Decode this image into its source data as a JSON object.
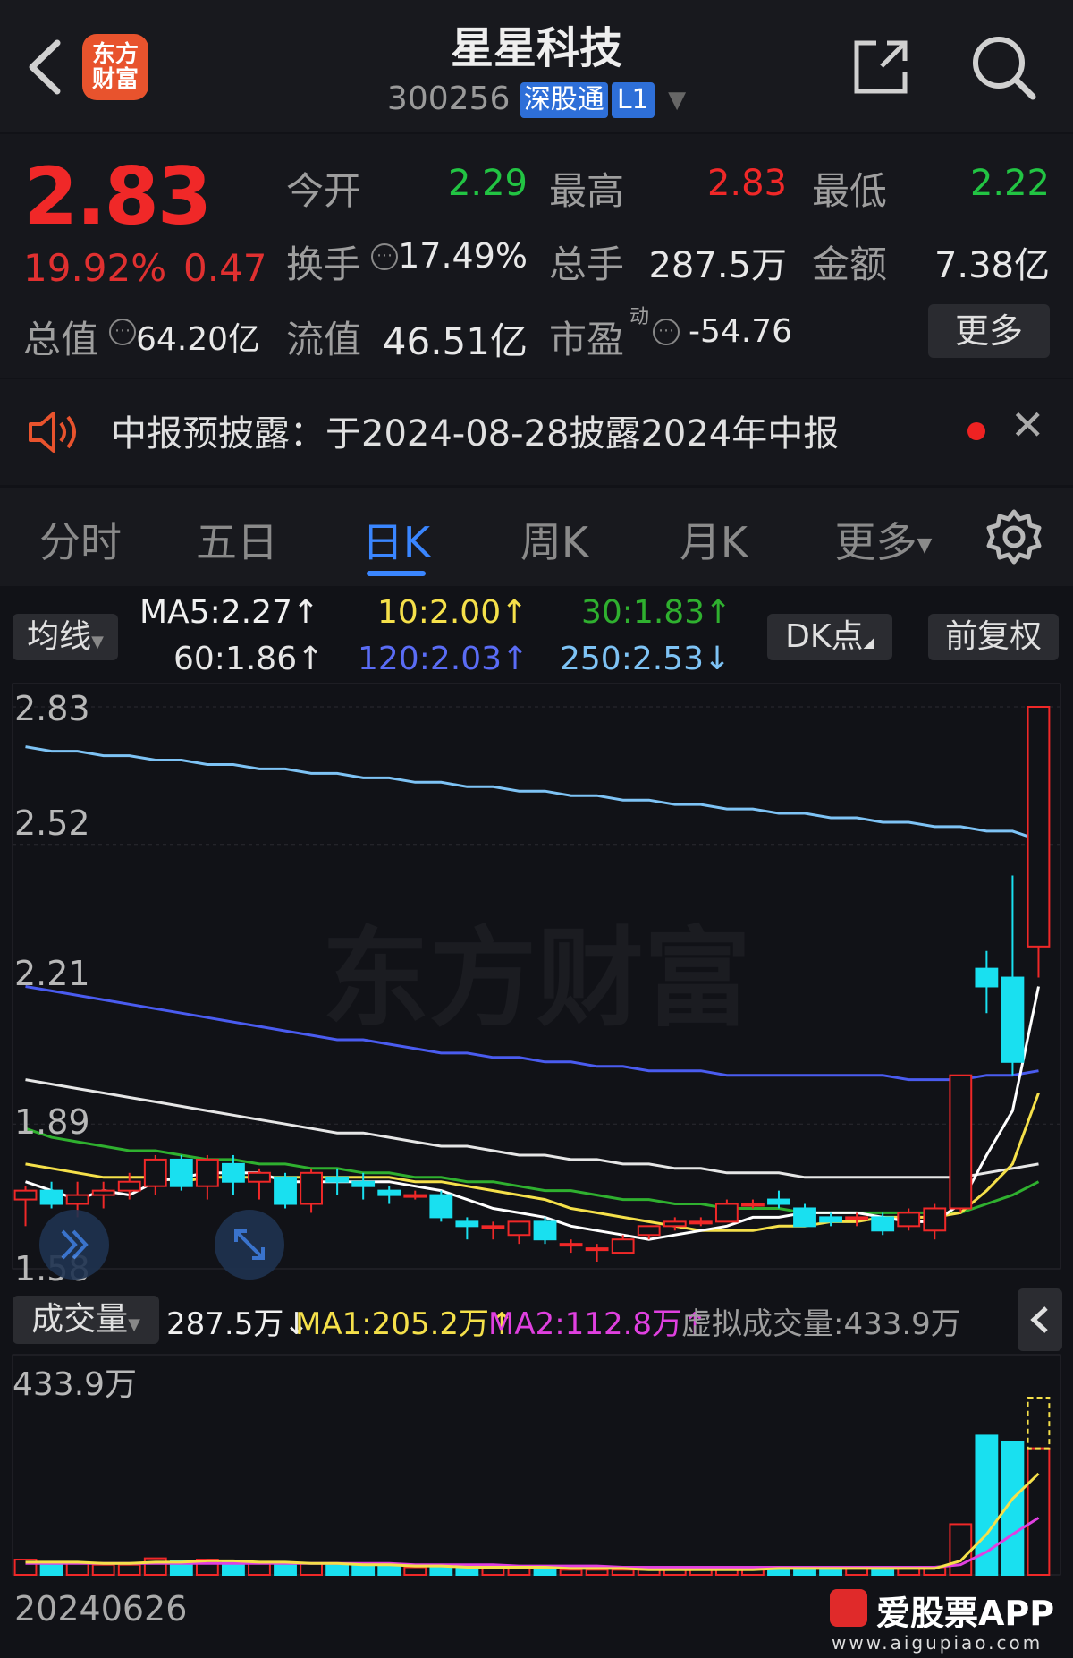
{
  "header": {
    "logo_line1": "东方",
    "logo_line2": "财富",
    "stock_name": "星星科技",
    "stock_code": "300256",
    "tag_connect": "深股通",
    "tag_level": "L1"
  },
  "quote": {
    "price": "2.83",
    "change_pct": "19.92%",
    "change": "0.47",
    "open_label": "今开",
    "open": "2.29",
    "high_label": "最高",
    "high": "2.83",
    "low_label": "最低",
    "low": "2.22",
    "turnover_label": "换手",
    "turnover": "17.49%",
    "volume_label": "总手",
    "volume": "287.5万",
    "amount_label": "金额",
    "amount": "7.38亿",
    "mktcap_label": "总值",
    "mktcap": "64.20亿",
    "float_label": "流值",
    "float_cap": "46.51亿",
    "pe_label": "市盈",
    "pe_super": "动",
    "pe": "-54.76",
    "more_label": "更多"
  },
  "notice": {
    "text": "中报预披露：于2024-08-28披露2024年中报"
  },
  "tabs": [
    {
      "label": "分时",
      "active": false
    },
    {
      "label": "五日",
      "active": false
    },
    {
      "label": "日K",
      "active": true
    },
    {
      "label": "周K",
      "active": false
    },
    {
      "label": "月K",
      "active": false
    },
    {
      "label": "更多",
      "active": false
    }
  ],
  "ma_bar": {
    "selector": "均线",
    "ma5": "MA5:2.27↑",
    "ma10": "10:2.00↑",
    "ma30": "30:1.83↑",
    "ma60": "60:1.86↑",
    "ma120": "120:2.03↑",
    "ma250": "250:2.53↓",
    "dk_button": "DK点",
    "adjust_button": "前复权"
  },
  "chart_labels": {
    "y_labels": [
      "2.83",
      "2.52",
      "2.21",
      "1.89",
      "1.58"
    ],
    "watermark": "东方财富"
  },
  "volume_bar": {
    "selector": "成交量",
    "vol": "287.5万↓",
    "ma1": "MA1:205.2万↑",
    "ma2": "MA2:112.8万↑",
    "virtual": "虚拟成交量:433.9万",
    "max_label": "433.9万",
    "date_label": "20240626"
  },
  "footer": {
    "brand": "爱股票APP",
    "url": "www.aigupiao.com"
  },
  "colors": {
    "up": "#f02828",
    "down": "#19e0f0",
    "accent": "#3a86ff",
    "ma5": "#ffffff",
    "ma10": "#f5e04a",
    "ma30": "#2fb02f",
    "ma60": "#e6e6e6",
    "ma120": "#4a5cf0",
    "ma250": "#7ec3f5",
    "vol_ma1": "#f5e04a",
    "vol_ma2": "#e040e0"
  },
  "chart_data": {
    "type": "candlestick",
    "y_range": [
      1.58,
      2.83
    ],
    "candles": [
      {
        "o": 1.72,
        "h": 1.75,
        "l": 1.66,
        "c": 1.74,
        "v": 12
      },
      {
        "o": 1.74,
        "h": 1.76,
        "l": 1.7,
        "c": 1.71,
        "v": 10
      },
      {
        "o": 1.71,
        "h": 1.76,
        "l": 1.68,
        "c": 1.73,
        "v": 9
      },
      {
        "o": 1.73,
        "h": 1.76,
        "l": 1.7,
        "c": 1.74,
        "v": 8
      },
      {
        "o": 1.74,
        "h": 1.78,
        "l": 1.72,
        "c": 1.76,
        "v": 8
      },
      {
        "o": 1.75,
        "h": 1.82,
        "l": 1.73,
        "c": 1.81,
        "v": 13
      },
      {
        "o": 1.81,
        "h": 1.82,
        "l": 1.74,
        "c": 1.75,
        "v": 11
      },
      {
        "o": 1.75,
        "h": 1.82,
        "l": 1.72,
        "c": 1.81,
        "v": 12
      },
      {
        "o": 1.8,
        "h": 1.82,
        "l": 1.73,
        "c": 1.76,
        "v": 10
      },
      {
        "o": 1.76,
        "h": 1.79,
        "l": 1.72,
        "c": 1.78,
        "v": 9
      },
      {
        "o": 1.77,
        "h": 1.78,
        "l": 1.7,
        "c": 1.71,
        "v": 9
      },
      {
        "o": 1.71,
        "h": 1.79,
        "l": 1.69,
        "c": 1.78,
        "v": 9
      },
      {
        "o": 1.77,
        "h": 1.79,
        "l": 1.73,
        "c": 1.76,
        "v": 8
      },
      {
        "o": 1.76,
        "h": 1.78,
        "l": 1.72,
        "c": 1.75,
        "v": 7
      },
      {
        "o": 1.74,
        "h": 1.75,
        "l": 1.71,
        "c": 1.73,
        "v": 7
      },
      {
        "o": 1.73,
        "h": 1.74,
        "l": 1.72,
        "c": 1.73,
        "v": 6
      },
      {
        "o": 1.73,
        "h": 1.74,
        "l": 1.67,
        "c": 1.68,
        "v": 7
      },
      {
        "o": 1.67,
        "h": 1.68,
        "l": 1.63,
        "c": 1.66,
        "v": 5
      },
      {
        "o": 1.66,
        "h": 1.67,
        "l": 1.63,
        "c": 1.66,
        "v": 5
      },
      {
        "o": 1.64,
        "h": 1.67,
        "l": 1.62,
        "c": 1.67,
        "v": 5
      },
      {
        "o": 1.67,
        "h": 1.68,
        "l": 1.62,
        "c": 1.63,
        "v": 5
      },
      {
        "o": 1.62,
        "h": 1.63,
        "l": 1.6,
        "c": 1.62,
        "v": 4
      },
      {
        "o": 1.61,
        "h": 1.62,
        "l": 1.58,
        "c": 1.61,
        "v": 4
      },
      {
        "o": 1.6,
        "h": 1.64,
        "l": 1.6,
        "c": 1.63,
        "v": 4
      },
      {
        "o": 1.64,
        "h": 1.66,
        "l": 1.63,
        "c": 1.66,
        "v": 4
      },
      {
        "o": 1.66,
        "h": 1.68,
        "l": 1.65,
        "c": 1.67,
        "v": 4
      },
      {
        "o": 1.67,
        "h": 1.68,
        "l": 1.66,
        "c": 1.67,
        "v": 4
      },
      {
        "o": 1.67,
        "h": 1.72,
        "l": 1.67,
        "c": 1.71,
        "v": 5
      },
      {
        "o": 1.71,
        "h": 1.72,
        "l": 1.7,
        "c": 1.71,
        "v": 5
      },
      {
        "o": 1.72,
        "h": 1.74,
        "l": 1.7,
        "c": 1.71,
        "v": 5
      },
      {
        "o": 1.7,
        "h": 1.71,
        "l": 1.66,
        "c": 1.66,
        "v": 5
      },
      {
        "o": 1.68,
        "h": 1.69,
        "l": 1.66,
        "c": 1.67,
        "v": 5
      },
      {
        "o": 1.68,
        "h": 1.69,
        "l": 1.66,
        "c": 1.68,
        "v": 5
      },
      {
        "o": 1.68,
        "h": 1.69,
        "l": 1.64,
        "c": 1.65,
        "v": 5
      },
      {
        "o": 1.66,
        "h": 1.7,
        "l": 1.65,
        "c": 1.69,
        "v": 6
      },
      {
        "o": 1.65,
        "h": 1.71,
        "l": 1.63,
        "c": 1.7,
        "v": 6
      },
      {
        "o": 1.7,
        "h": 2.0,
        "l": 1.69,
        "c": 2.0,
        "v": 40
      },
      {
        "o": 2.24,
        "h": 2.28,
        "l": 2.14,
        "c": 2.2,
        "v": 110
      },
      {
        "o": 2.22,
        "h": 2.45,
        "l": 2.0,
        "c": 2.03,
        "v": 105
      },
      {
        "o": 2.29,
        "h": 2.83,
        "l": 2.22,
        "c": 2.83,
        "v": 100
      }
    ],
    "vol_max_virtual": 140,
    "lines": {
      "ma5": [
        1.76,
        1.74,
        1.72,
        1.74,
        1.73,
        1.76,
        1.77,
        1.78,
        1.78,
        1.78,
        1.76,
        1.76,
        1.76,
        1.76,
        1.76,
        1.75,
        1.74,
        1.72,
        1.7,
        1.69,
        1.68,
        1.66,
        1.65,
        1.64,
        1.63,
        1.64,
        1.65,
        1.66,
        1.68,
        1.68,
        1.69,
        1.69,
        1.69,
        1.68,
        1.67,
        1.67,
        1.71,
        1.82,
        1.92,
        2.2
      ],
      "ma10": [
        1.8,
        1.79,
        1.78,
        1.77,
        1.77,
        1.77,
        1.76,
        1.77,
        1.77,
        1.77,
        1.77,
        1.77,
        1.77,
        1.77,
        1.77,
        1.76,
        1.76,
        1.75,
        1.74,
        1.73,
        1.72,
        1.7,
        1.69,
        1.68,
        1.67,
        1.66,
        1.65,
        1.65,
        1.65,
        1.66,
        1.66,
        1.67,
        1.67,
        1.68,
        1.68,
        1.68,
        1.69,
        1.74,
        1.8,
        1.96
      ],
      "ma30": [
        1.88,
        1.86,
        1.85,
        1.84,
        1.83,
        1.83,
        1.82,
        1.81,
        1.81,
        1.8,
        1.8,
        1.79,
        1.79,
        1.78,
        1.78,
        1.77,
        1.77,
        1.76,
        1.76,
        1.75,
        1.74,
        1.74,
        1.73,
        1.72,
        1.72,
        1.71,
        1.71,
        1.7,
        1.7,
        1.7,
        1.69,
        1.69,
        1.69,
        1.69,
        1.69,
        1.69,
        1.69,
        1.71,
        1.73,
        1.76
      ],
      "ma60": [
        1.99,
        1.98,
        1.97,
        1.96,
        1.95,
        1.94,
        1.93,
        1.92,
        1.91,
        1.9,
        1.89,
        1.88,
        1.87,
        1.87,
        1.86,
        1.85,
        1.84,
        1.84,
        1.83,
        1.82,
        1.82,
        1.81,
        1.81,
        1.8,
        1.8,
        1.79,
        1.79,
        1.78,
        1.78,
        1.78,
        1.77,
        1.77,
        1.77,
        1.77,
        1.77,
        1.77,
        1.77,
        1.78,
        1.79,
        1.8
      ],
      "ma120": [
        2.2,
        2.19,
        2.18,
        2.17,
        2.16,
        2.15,
        2.14,
        2.13,
        2.12,
        2.11,
        2.1,
        2.09,
        2.08,
        2.08,
        2.07,
        2.06,
        2.05,
        2.05,
        2.04,
        2.04,
        2.03,
        2.03,
        2.02,
        2.02,
        2.01,
        2.01,
        2.01,
        2.0,
        2.0,
        2.0,
        2.0,
        2.0,
        2.0,
        2.0,
        1.99,
        1.99,
        1.99,
        2.0,
        2.0,
        2.01
      ],
      "ma250": [
        2.74,
        2.73,
        2.73,
        2.72,
        2.72,
        2.71,
        2.71,
        2.7,
        2.7,
        2.69,
        2.69,
        2.68,
        2.68,
        2.67,
        2.67,
        2.66,
        2.66,
        2.65,
        2.65,
        2.64,
        2.64,
        2.63,
        2.63,
        2.62,
        2.62,
        2.61,
        2.61,
        2.6,
        2.6,
        2.59,
        2.59,
        2.58,
        2.58,
        2.57,
        2.57,
        2.56,
        2.56,
        2.55,
        2.55,
        2.53
      ],
      "vol_ma1": [
        10,
        10,
        10,
        9,
        9,
        10,
        10,
        11,
        11,
        10,
        10,
        9,
        9,
        8,
        8,
        7,
        7,
        6,
        6,
        6,
        6,
        5,
        5,
        5,
        4,
        4,
        4,
        4,
        4,
        5,
        5,
        5,
        5,
        5,
        5,
        5,
        11,
        32,
        60,
        80
      ],
      "vol_ma2": [
        9,
        9,
        9,
        9,
        9,
        9,
        9,
        9,
        9,
        9,
        9,
        9,
        9,
        9,
        9,
        8,
        8,
        8,
        8,
        7,
        7,
        7,
        7,
        6,
        6,
        6,
        6,
        6,
        6,
        6,
        6,
        6,
        6,
        6,
        6,
        6,
        8,
        18,
        32,
        45
      ]
    }
  }
}
